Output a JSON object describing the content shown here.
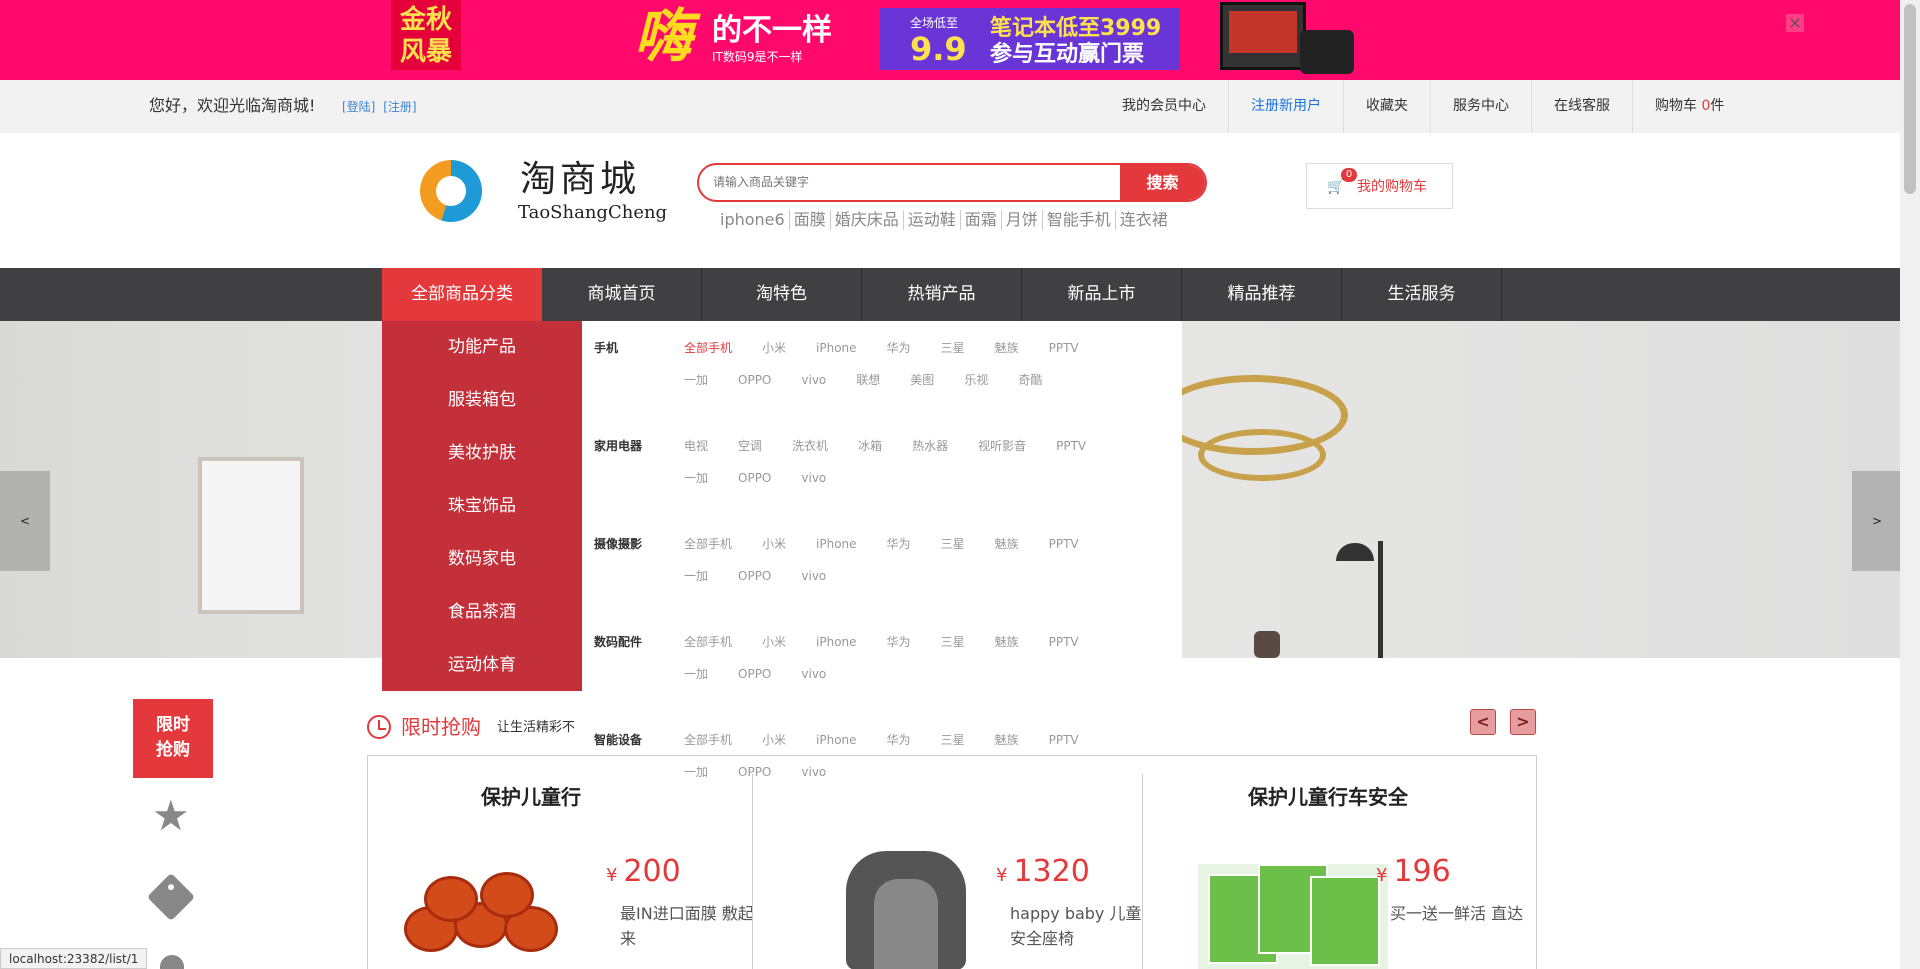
{
  "promo": {
    "logo_text": "金秋风暴",
    "hi": "嗨",
    "slogan": "的不一样",
    "sub": "IT数码9是不一样",
    "box_line1": "全场低至",
    "box_price": "9.9",
    "box_line2": "笔记本低至3999",
    "box_line3": "参与互动赢门票",
    "close": "×"
  },
  "topbar": {
    "welcome": "您好，欢迎光临淘商城!",
    "login": "[登陆]",
    "register": "[注册]",
    "links": [
      "我的会员中心",
      "注册新用户",
      "收藏夹",
      "服务中心",
      "在线客服"
    ],
    "cart_label": "购物车",
    "cart_count": "0",
    "cart_unit": "件"
  },
  "header": {
    "logo_cn": "淘商城",
    "logo_en": "TaoShangCheng",
    "search_placeholder": "请输入商品关键字",
    "search_button": "搜索",
    "hotwords": [
      "iphone6",
      "面膜",
      "婚庆床品",
      "运动鞋",
      "面霜",
      "月饼",
      "智能手机",
      "连衣裙"
    ],
    "cart_badge": "0",
    "cart_text": "我的购物车"
  },
  "nav": [
    "全部商品分类",
    "商城首页",
    "淘特色",
    "热销产品",
    "新品上市",
    "精品推荐",
    "生活服务"
  ],
  "hero": {
    "prev": "<",
    "next": ">"
  },
  "categories": [
    "功能产品",
    "服装箱包",
    "美妆护肤",
    "珠宝饰品",
    "数码家电",
    "食品茶酒",
    "运动体育"
  ],
  "dropdown": [
    {
      "title": "手机",
      "items": [
        "全部手机",
        "小米",
        "iPhone",
        "华为",
        "三星",
        "魅族",
        "PPTV",
        "一加",
        "OPPO",
        "vivo",
        "联想",
        "美图",
        "乐视",
        "奇酷"
      ]
    },
    {
      "title": "家用电器",
      "items": [
        "电视",
        "空调",
        "洗衣机",
        "冰箱",
        "热水器",
        "视听影音",
        "PPTV",
        "一加",
        "OPPO",
        "vivo"
      ]
    },
    {
      "title": "摄像摄影",
      "items": [
        "全部手机",
        "小米",
        "iPhone",
        "华为",
        "三星",
        "魅族",
        "PPTV",
        "一加",
        "OPPO",
        "vivo"
      ]
    },
    {
      "title": "数码配件",
      "items": [
        "全部手机",
        "小米",
        "iPhone",
        "华为",
        "三星",
        "魅族",
        "PPTV",
        "一加",
        "OPPO",
        "vivo"
      ]
    },
    {
      "title": "智能设备",
      "items": [
        "全部手机",
        "小米",
        "iPhone",
        "华为",
        "三星",
        "魅族",
        "PPTV",
        "一加",
        "OPPO",
        "vivo"
      ]
    }
  ],
  "sidebar": {
    "flash_line1": "限时",
    "flash_line2": "抢购"
  },
  "flash": {
    "title": "限时抢购",
    "subtitle": "让生活精彩不",
    "prev": "<",
    "next": ">"
  },
  "products": [
    {
      "title": "保护儿童行",
      "currency": "¥",
      "price": "200",
      "desc": "最IN进口面膜 敷起来"
    },
    {
      "title": "",
      "currency": "¥",
      "price": "1320",
      "desc": "happy baby 儿童安全座椅"
    },
    {
      "title": "保护儿童行车安全",
      "currency": "¥",
      "price": "196",
      "desc": "买一送一鲜活 直达"
    }
  ],
  "status_url": "localhost:23382/list/1"
}
